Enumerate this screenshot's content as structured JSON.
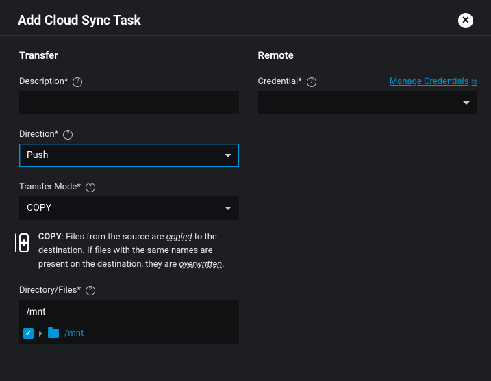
{
  "dialog": {
    "title": "Add Cloud Sync Task"
  },
  "transfer": {
    "section_title": "Transfer",
    "description_label": "Description*",
    "description_value": "",
    "direction_label": "Direction*",
    "direction_value": "Push",
    "mode_label": "Transfer Mode*",
    "mode_value": "COPY",
    "info": {
      "strong": "COPY",
      "part1": ": Files from the source are ",
      "em1": "copied",
      "part2": " to the destination. If files with the same names are present on the destination, they are ",
      "em2": "overwritten",
      "part3": "."
    },
    "dirfiles_label": "Directory/Files*",
    "dirfiles_value": "/mnt",
    "tree_item": "/mnt"
  },
  "remote": {
    "section_title": "Remote",
    "credential_label": "Credential*",
    "credential_value": "",
    "manage_link": "Manage Credentials"
  }
}
